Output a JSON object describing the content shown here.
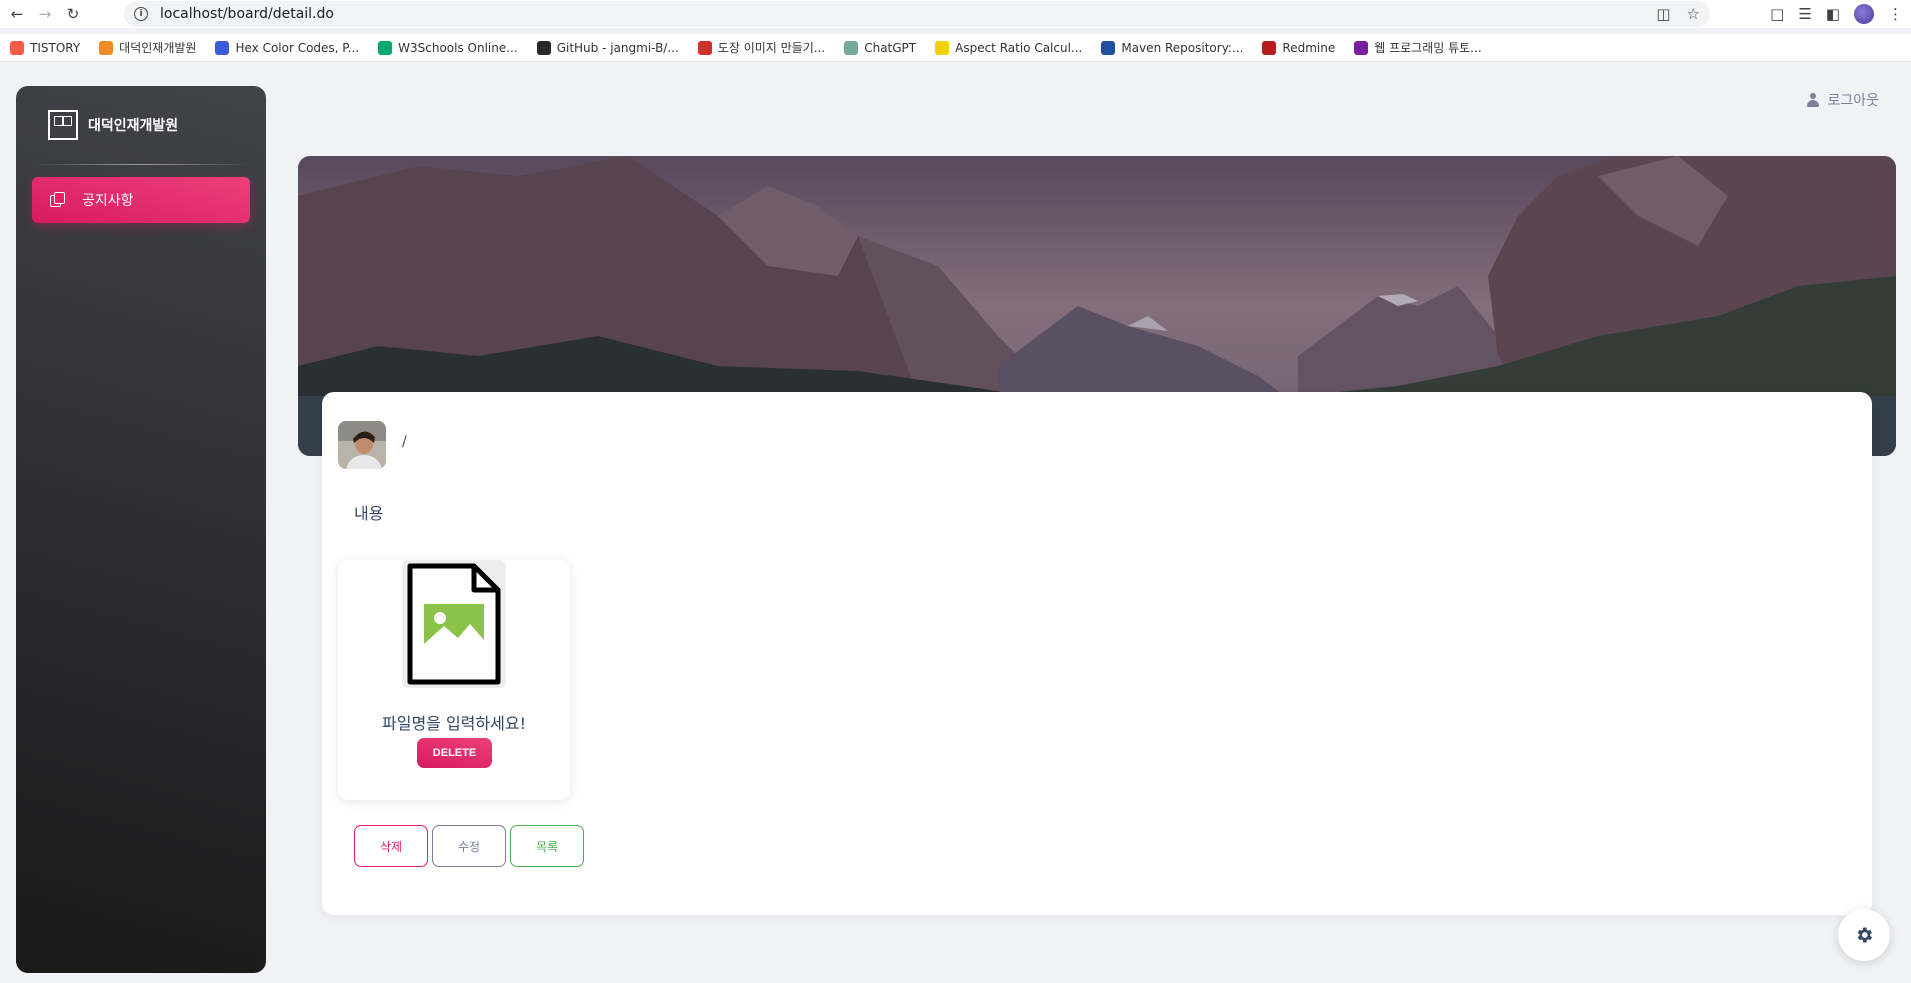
{
  "browser": {
    "url": "localhost/board/detail.do",
    "bookmarks": [
      {
        "label": "TISTORY",
        "color": "#ff5a4a"
      },
      {
        "label": "대덕인재개발원",
        "color": "#f08a24"
      },
      {
        "label": "Hex Color Codes, P...",
        "color": "#3b5bdb"
      },
      {
        "label": "W3Schools Online...",
        "color": "#04aa6d"
      },
      {
        "label": "GitHub - jangmi-B/...",
        "color": "#24292e"
      },
      {
        "label": "도장 이미지 만들기...",
        "color": "#d32f2f"
      },
      {
        "label": "ChatGPT",
        "color": "#74aa9c"
      },
      {
        "label": "Aspect Ratio Calcul...",
        "color": "#f5d000"
      },
      {
        "label": "Maven Repository:...",
        "color": "#1e4e9c"
      },
      {
        "label": "Redmine",
        "color": "#b71c1c"
      },
      {
        "label": "웹 프로그래밍 튜토...",
        "color": "#7b1fa2"
      }
    ]
  },
  "sidebar": {
    "brand": "대덕인재개발원",
    "items": [
      {
        "label": "공지사항"
      }
    ]
  },
  "header": {
    "logout_label": "로그아웃"
  },
  "post": {
    "title": "/",
    "content": "내용",
    "file": {
      "name": "파일명을 입력하세요!",
      "delete_label": "DELETE"
    },
    "actions": {
      "delete_label": "삭제",
      "edit_label": "수정",
      "list_label": "목록"
    }
  },
  "colors": {
    "primary": "#e91e63",
    "secondary": "#7b809a",
    "success": "#4caf50",
    "text": "#344767"
  }
}
